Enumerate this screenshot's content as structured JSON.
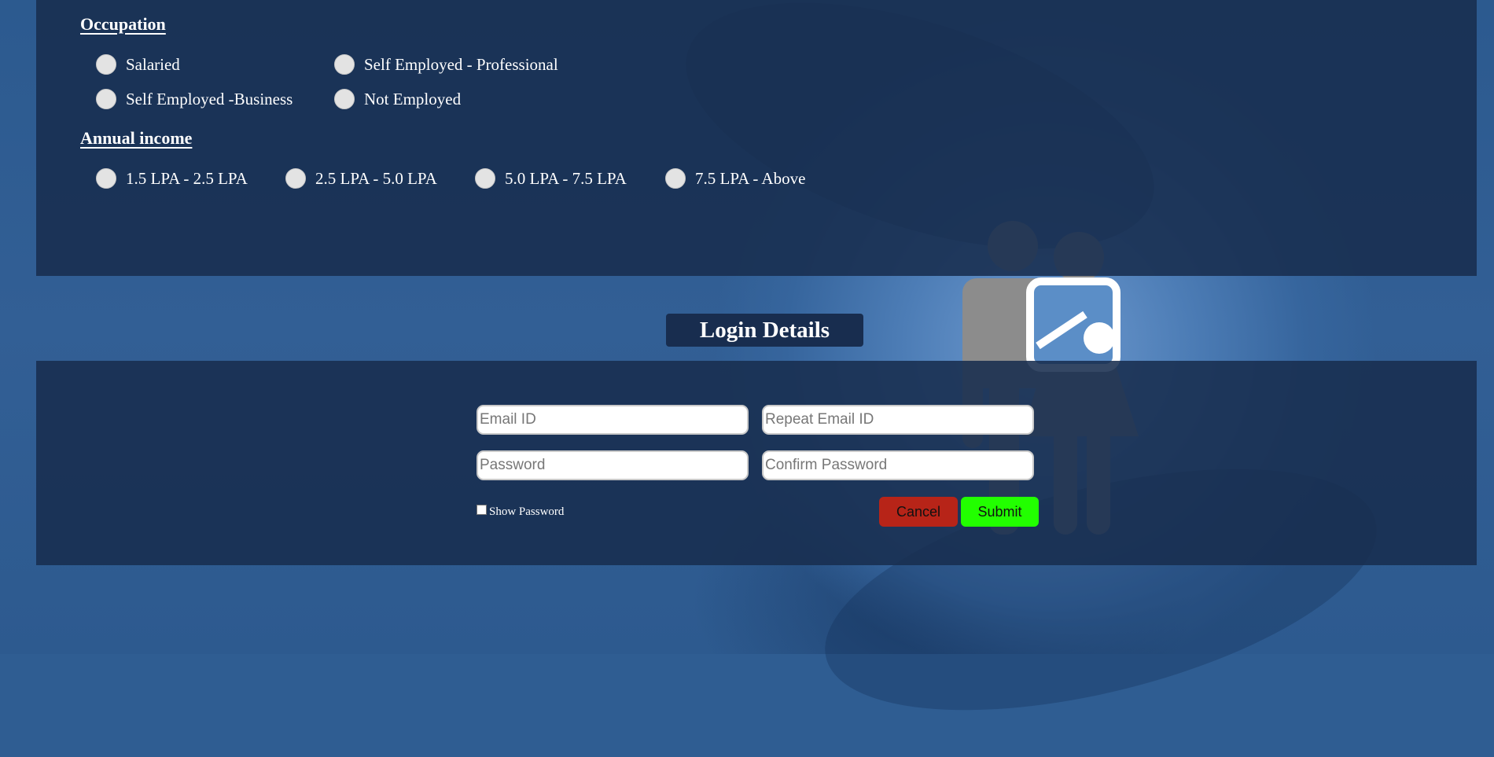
{
  "occupation": {
    "title": "Occupation",
    "options": [
      "Salaried",
      "Self Employed - Professional",
      "Self Employed -Business",
      "Not Employed"
    ]
  },
  "income": {
    "title": "Annual income",
    "options": [
      "1.5 LPA - 2.5 LPA",
      "2.5 LPA - 5.0 LPA",
      "5.0 LPA - 7.5 LPA",
      "7.5 LPA - Above"
    ]
  },
  "login": {
    "title": "Login Details",
    "email_placeholder": "Email ID",
    "repeat_email_placeholder": "Repeat Email ID",
    "password_placeholder": "Password",
    "confirm_password_placeholder": "Confirm Password",
    "show_password_label": "Show Password",
    "cancel_label": "Cancel",
    "submit_label": "Submit"
  },
  "colors": {
    "panel": "#182d4f",
    "background": "#2f5d92",
    "cancel": "#b72418",
    "submit": "#22ff00"
  }
}
